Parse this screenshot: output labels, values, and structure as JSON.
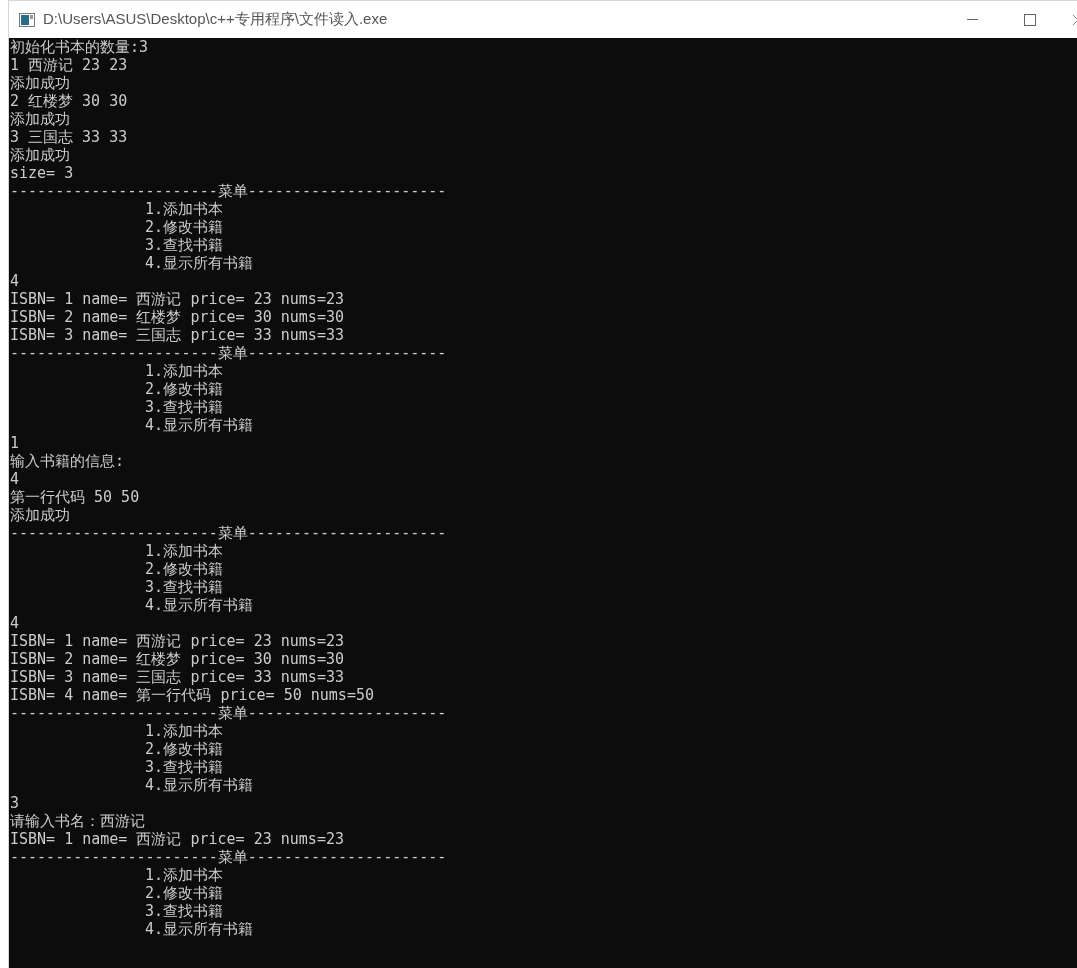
{
  "window": {
    "title": "D:\\Users\\ASUS\\Desktop\\c++专用程序\\文件读入.exe"
  },
  "console": {
    "lines": [
      {
        "kind": "text",
        "text": "初始化书本的数量:3"
      },
      {
        "kind": "text",
        "text": "1 西游记 23 23"
      },
      {
        "kind": "text",
        "text": "添加成功"
      },
      {
        "kind": "text",
        "text": "2 红楼梦 30 30"
      },
      {
        "kind": "text",
        "text": "添加成功"
      },
      {
        "kind": "text",
        "text": "3 三国志 33 33"
      },
      {
        "kind": "text",
        "text": "添加成功"
      },
      {
        "kind": "text",
        "text": "size= 3"
      },
      {
        "kind": "rule",
        "text": "-----------------------菜单----------------------"
      },
      {
        "kind": "menu_item",
        "text": "1.添加书本"
      },
      {
        "kind": "menu_item",
        "text": "2.修改书籍"
      },
      {
        "kind": "menu_item",
        "text": "3.查找书籍"
      },
      {
        "kind": "menu_item",
        "text": "4.显示所有书籍"
      },
      {
        "kind": "text",
        "text": "4"
      },
      {
        "kind": "text",
        "text": "ISBN= 1 name= 西游记 price= 23 nums=23"
      },
      {
        "kind": "text",
        "text": "ISBN= 2 name= 红楼梦 price= 30 nums=30"
      },
      {
        "kind": "text",
        "text": "ISBN= 3 name= 三国志 price= 33 nums=33"
      },
      {
        "kind": "rule",
        "text": "-----------------------菜单----------------------"
      },
      {
        "kind": "menu_item",
        "text": "1.添加书本"
      },
      {
        "kind": "menu_item",
        "text": "2.修改书籍"
      },
      {
        "kind": "menu_item",
        "text": "3.查找书籍"
      },
      {
        "kind": "menu_item",
        "text": "4.显示所有书籍"
      },
      {
        "kind": "text",
        "text": "1"
      },
      {
        "kind": "text",
        "text": "输入书籍的信息:"
      },
      {
        "kind": "text",
        "text": "4"
      },
      {
        "kind": "text",
        "text": "第一行代码 50 50"
      },
      {
        "kind": "text",
        "text": "添加成功"
      },
      {
        "kind": "rule",
        "text": "-----------------------菜单----------------------"
      },
      {
        "kind": "menu_item",
        "text": "1.添加书本"
      },
      {
        "kind": "menu_item",
        "text": "2.修改书籍"
      },
      {
        "kind": "menu_item",
        "text": "3.查找书籍"
      },
      {
        "kind": "menu_item",
        "text": "4.显示所有书籍"
      },
      {
        "kind": "text",
        "text": "4"
      },
      {
        "kind": "text",
        "text": "ISBN= 1 name= 西游记 price= 23 nums=23"
      },
      {
        "kind": "text",
        "text": "ISBN= 2 name= 红楼梦 price= 30 nums=30"
      },
      {
        "kind": "text",
        "text": "ISBN= 3 name= 三国志 price= 33 nums=33"
      },
      {
        "kind": "text",
        "text": "ISBN= 4 name= 第一行代码 price= 50 nums=50"
      },
      {
        "kind": "rule",
        "text": "-----------------------菜单----------------------"
      },
      {
        "kind": "menu_item",
        "text": "1.添加书本"
      },
      {
        "kind": "menu_item",
        "text": "2.修改书籍"
      },
      {
        "kind": "menu_item",
        "text": "3.查找书籍"
      },
      {
        "kind": "menu_item",
        "text": "4.显示所有书籍"
      },
      {
        "kind": "text",
        "text": "3"
      },
      {
        "kind": "text",
        "text": "请输入书名：西游记"
      },
      {
        "kind": "text",
        "text": "ISBN= 1 name= 西游记 price= 23 nums=23"
      },
      {
        "kind": "rule",
        "text": "-----------------------菜单----------------------"
      },
      {
        "kind": "menu_item",
        "text": "1.添加书本"
      },
      {
        "kind": "menu_item",
        "text": "2.修改书籍"
      },
      {
        "kind": "menu_item",
        "text": "3.查找书籍"
      },
      {
        "kind": "menu_item",
        "text": "4.显示所有书籍"
      }
    ]
  }
}
